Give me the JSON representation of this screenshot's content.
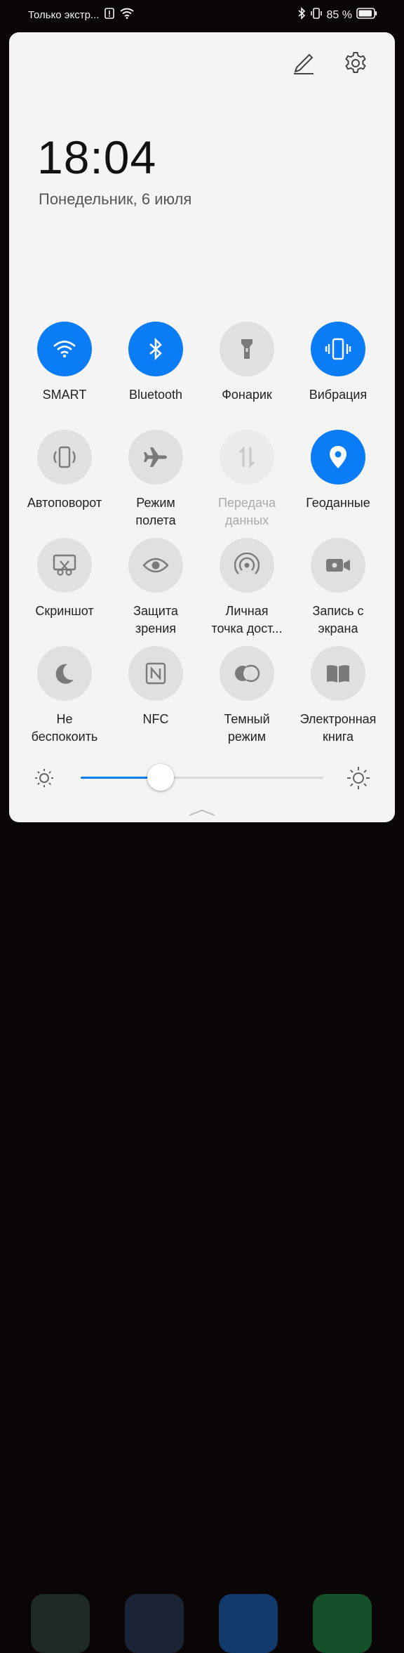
{
  "status_bar": {
    "carrier_text": "Только экстр...",
    "battery_text": "85 %"
  },
  "panel": {
    "time": "18:04",
    "date": "Понедельник, 6 июля"
  },
  "tiles": [
    {
      "label": "SMART",
      "icon": "wifi-icon",
      "on": true
    },
    {
      "label": "Bluetooth",
      "icon": "bluetooth-icon",
      "on": true
    },
    {
      "label": "Фонарик",
      "icon": "flashlight-icon",
      "on": false
    },
    {
      "label": "Вибрация",
      "icon": "vibration-icon",
      "on": true
    },
    {
      "label": "Автоповорот",
      "icon": "autorotate-icon",
      "on": false
    },
    {
      "label": "Режим\nполета",
      "icon": "airplane-icon",
      "on": false
    },
    {
      "label": "Передача\nданных",
      "icon": "mobile-data-icon",
      "on": false,
      "disabled": true
    },
    {
      "label": "Геоданные",
      "icon": "location-icon",
      "on": true
    },
    {
      "label": "Скриншот",
      "icon": "screenshot-icon",
      "on": false
    },
    {
      "label": "Защита\nзрения",
      "icon": "eye-icon",
      "on": false
    },
    {
      "label": "Личная\nточка дост...",
      "icon": "hotspot-icon",
      "on": false
    },
    {
      "label": "Запись с\nэкрана",
      "icon": "screen-record-icon",
      "on": false
    },
    {
      "label": "Не\nбеспокоить",
      "icon": "moon-icon",
      "on": false
    },
    {
      "label": "NFC",
      "icon": "nfc-icon",
      "on": false
    },
    {
      "label": "Темный\nрежим",
      "icon": "dark-mode-icon",
      "on": false
    },
    {
      "label": "Электронная\nкнига",
      "icon": "ebook-icon",
      "on": false
    }
  ],
  "brightness": {
    "level": 0.33
  },
  "colors": {
    "accent": "#0a7cf5",
    "tile_off": "#e0e0e0",
    "panel_bg": "#f4f4f4"
  }
}
